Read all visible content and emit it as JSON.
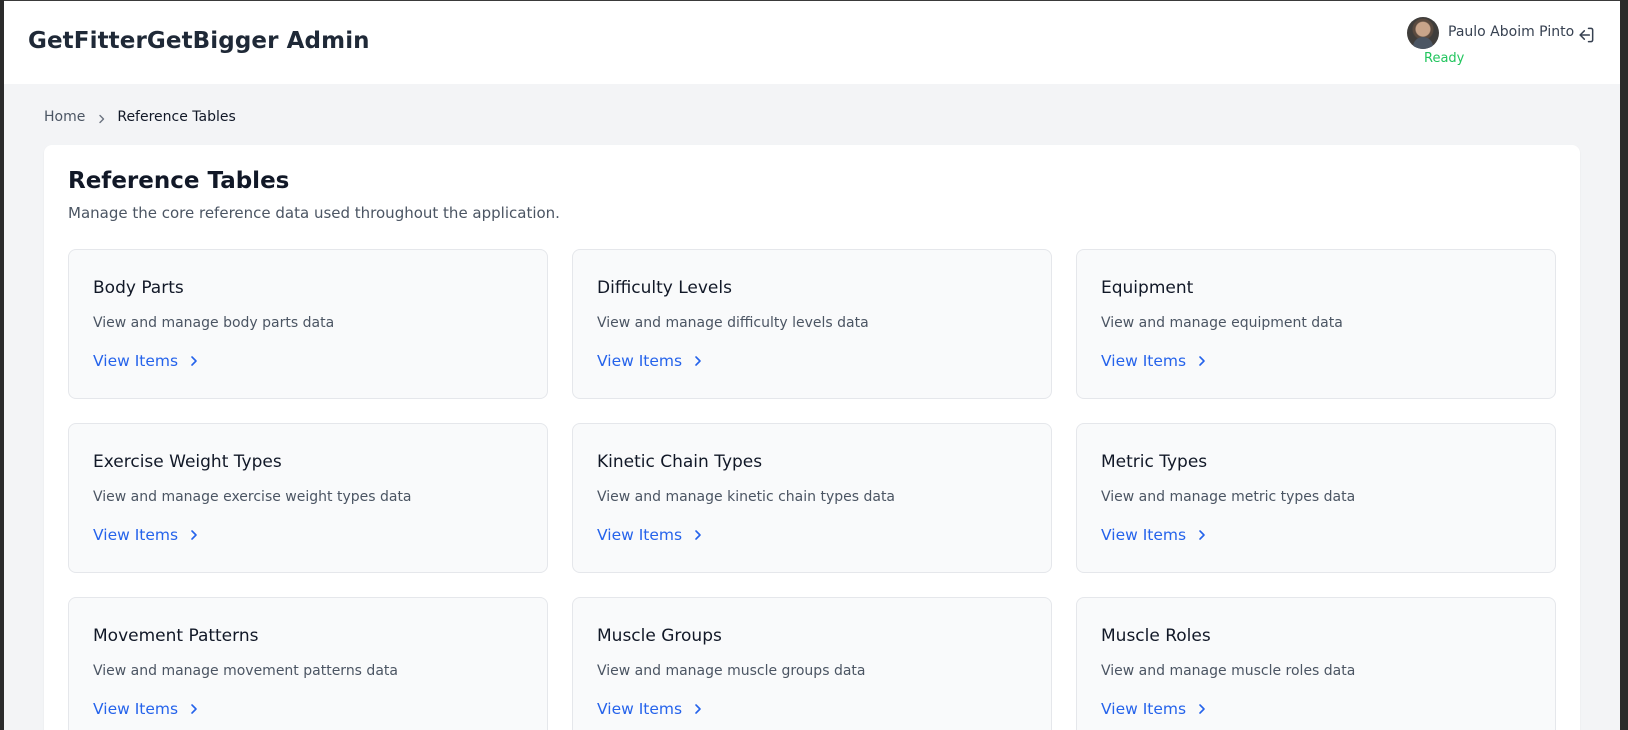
{
  "header": {
    "app_title": "GetFitterGetBigger Admin",
    "user_name": "Paulo Aboim Pinto",
    "status": "Ready"
  },
  "breadcrumb": {
    "home": "Home",
    "current": "Reference Tables"
  },
  "main": {
    "title": "Reference Tables",
    "subtitle": "Manage the core reference data used throughout the application.",
    "cards": [
      {
        "title": "Body Parts",
        "description": "View and manage body parts data",
        "link": "View Items"
      },
      {
        "title": "Difficulty Levels",
        "description": "View and manage difficulty levels data",
        "link": "View Items"
      },
      {
        "title": "Equipment",
        "description": "View and manage equipment data",
        "link": "View Items"
      },
      {
        "title": "Exercise Weight Types",
        "description": "View and manage exercise weight types data",
        "link": "View Items"
      },
      {
        "title": "Kinetic Chain Types",
        "description": "View and manage kinetic chain types data",
        "link": "View Items"
      },
      {
        "title": "Metric Types",
        "description": "View and manage metric types data",
        "link": "View Items"
      },
      {
        "title": "Movement Patterns",
        "description": "View and manage movement patterns data",
        "link": "View Items"
      },
      {
        "title": "Muscle Groups",
        "description": "View and manage muscle groups data",
        "link": "View Items"
      },
      {
        "title": "Muscle Roles",
        "description": "View and manage muscle roles data",
        "link": "View Items"
      }
    ]
  },
  "icons": {
    "breadcrumb_separator": "chevron-right-icon",
    "card_link": "chevron-right-icon",
    "logout": "logout-icon",
    "avatar": "user-avatar"
  },
  "colors": {
    "link": "#2563eb",
    "status": "#22c55e",
    "background": "#f3f4f6"
  }
}
